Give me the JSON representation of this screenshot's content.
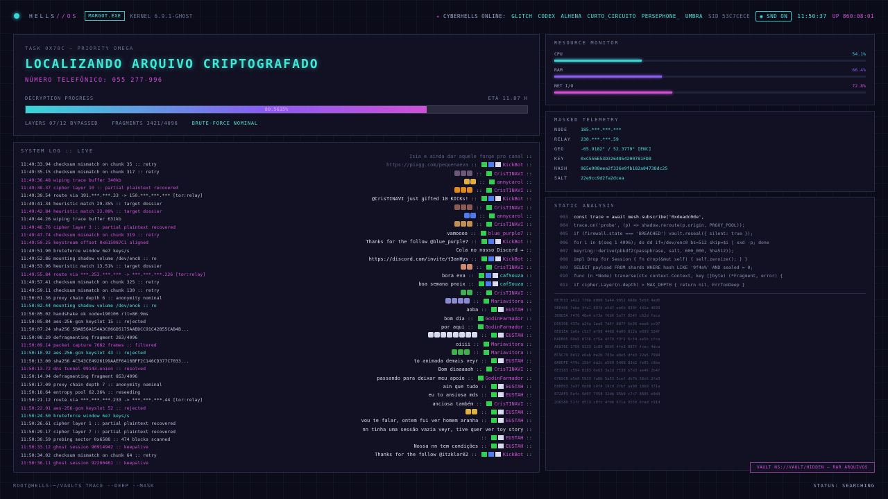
{
  "topbar": {
    "brand_a": "HELLS",
    "brand_b": "//OS",
    "exe": "MARGOT.EXE",
    "kernel": "KERNEL 6.9.1-GHOST",
    "online_label": "CYBERHELLS ONLINE:",
    "users": [
      "GLITCH",
      "CODEX",
      "ALHENA",
      "CURTO_CIRCUITO",
      "PERSEPHONE_",
      "UMBRA"
    ],
    "sid": "SID 53C7CECE",
    "snd": "SND ON",
    "clock": "11:50:37",
    "uptime": "UP 860:08:01"
  },
  "task": {
    "id": "TASK 0X70C — PRIORITY OMEGA",
    "title": "LOCALIZANDO ARQUIVO CRIPTOGRAFADO",
    "phone": "NÚMERO TELEFÔNICO: 055 277-996",
    "progress_label": "DECRYPTION PROGRESS",
    "eta": "ETA 11.87 H",
    "progress": 0.8,
    "progress_text": "80.5635%",
    "layers": "LAYERS 07/12 BYPASSED",
    "fragments": "FRAGMENTS 3421/4096",
    "mode": "BRUTE-FORCE NOMINAL"
  },
  "resource": {
    "title": "RESOURCE MONITOR",
    "items": [
      {
        "label": "CPU",
        "value": "54.1%",
        "level": 0.541,
        "color": "#38d6d6"
      },
      {
        "label": "RAM",
        "value": "66.4%",
        "level": 0.664,
        "color": "#8a5cf0"
      },
      {
        "label": "NET I/O",
        "value": "72.8%",
        "level": 0.728,
        "color": "#d050d8"
      }
    ]
  },
  "telemetry": {
    "title": "MASKED TELEMETRY",
    "rows": [
      {
        "k": "NODE",
        "v": "185.***.***.***"
      },
      {
        "k": "RELAY",
        "v": "230.***.***.59"
      },
      {
        "k": "GEO",
        "v": "-65.9182° / 52.3779° [ENC]"
      },
      {
        "k": "KEY",
        "v": "0xC556E53D3264854200781FDB"
      },
      {
        "k": "HASH",
        "v": "965e908eea2f336e9fb182a84738dc25"
      },
      {
        "k": "SALT",
        "v": "22e9cc9d2fa2dcea"
      }
    ]
  },
  "static": {
    "title": "STATIC ANALYSIS",
    "code": [
      {
        "n": "003",
        "t": "const trace = await mesh.subscribe('0xdeadc0de',",
        "hl": true
      },
      {
        "n": "004",
        "t": "trace.on('probe', (p) => shadow.reroute(p.origin, PROXY_POOL));",
        "hl": false
      },
      {
        "n": "005",
        "t": "if (firewall.state === 'BREACHED') vault.reseal({ silent: true });",
        "hl": false
      },
      {
        "n": "006",
        "t": "for i in $(seq 1 4096); do dd if=/dev/enc0 bs=512 skip=$i | xxd -p; done",
        "hl": false
      },
      {
        "n": "007",
        "t": "keyring::derive(pbkdf2(passphrase, salt, 600_000, Sha512));",
        "hl": false
      },
      {
        "n": "008",
        "t": "impl Drop for Session { fn drop(&mut self) { self.zeroize(); } }",
        "hl": false
      },
      {
        "n": "009",
        "t": "SELECT payload FROM shards WHERE hash LIKE '9f4a%' AND sealed = 0;",
        "hl": false
      },
      {
        "n": "010",
        "t": "func (n *Node) traverse(ctx context.Context, key []byte) (*Fragment, error) {",
        "hl": false
      },
      {
        "n": "011",
        "t": "if cipher.Layer(n.depth) > MAX_DEPTH { return nil, ErrTooDeep }",
        "hl": false
      }
    ],
    "hex": [
      "0E7033 a412 776b d000 5a44 9952 668e 5e58 4ad0",
      "5EE406 7ebe 3fa1 807d e5d7 eb6b 839f 441a 4693",
      "369D5A f476 48e4 ef3e f6b6 5a7f 854f c62d faca",
      "D55356 437e a24a 1ea6 7d5f 887f 6e36 eee8 cc97",
      "8E81EA 1a6a c927 af98 4468 4a06 812a e899 584f",
      "BADB05 60a5 8736 cf5a 4f70 f3f1 6cf4 ee5b cfca",
      "A6876C 1756 9133 1c89 86b5 4fe3 887f fcec 4dca",
      "EC9C79 8d12 e6ab de2b 703e a8e5 dfe3 22a5 7994",
      "8A0DFE 4f9c 15bf da2c e509 5488 83b2 fe05 c8be",
      "6E3183 c594 8183 6e63 3a2d f538 b7e3 ae46 2b47",
      "0789CB a5e0 5933 fa8b 5a53 5cef db7b 58c6 2fa3",
      "E86E63 3a37 0d08 c9f4 19cd 2fbf aa00 18b9 371a",
      "872AF3 6efc 9d07 7458 32db 95b9 c7c7 8895 e0d3",
      "206580 51fc d513 c0fc 4fdb 671e 9550 6cad c91d"
    ],
    "vault": "VAULT NS://VAULT/HIDDEN — RAR ARQUIVOS"
  },
  "syslog": {
    "title": "SYSTEM LOG :: LIVE",
    "lines": [
      {
        "t": "11:49:33.94 checksum mismatch on chunk 35 :: retry",
        "c": ""
      },
      {
        "t": "11:49:35.15 checksum mismatch on chunk 317 :: retry",
        "c": ""
      },
      {
        "t": "11:49:36.48 wiping trace buffer 340kb",
        "c": "pink"
      },
      {
        "t": "11:49:38.37 cipher layer 10 :: partial plaintext recovered",
        "c": "pink"
      },
      {
        "t": "11:49:39.54 route via 191.***.***.33 -> 150.***.***.*** [tor:relay]",
        "c": ""
      },
      {
        "t": "11:49:41.34 heuristic match 29.35% :: target dossier",
        "c": ""
      },
      {
        "t": "11:49:42.84 heuristic match 33.09% :: target dossier",
        "c": "pink"
      },
      {
        "t": "11:49:44.26 wiping trace buffer 631kb",
        "c": ""
      },
      {
        "t": "11:49:46.76 cipher layer 3 :: partial plaintext recovered",
        "c": "pink"
      },
      {
        "t": "11:49:47.74 checksum mismatch on chunk 319 :: retry",
        "c": "pink"
      },
      {
        "t": "11:49:50.25 keystream offset 0x615987C1 aligned",
        "c": "pink"
      },
      {
        "t": "11:49:51.90 bruteforce window 6e7 keys/s",
        "c": ""
      },
      {
        "t": "11:49:52.86 mounting shadow volume /dev/enc8 :: ro",
        "c": ""
      },
      {
        "t": "11:49:53.96 heuristic match 13.51% :: target dossier",
        "c": ""
      },
      {
        "t": "11:49:55.84 route via ***.253.***.*** -> ***.***.***.226 [tor:relay]",
        "c": "pink"
      },
      {
        "t": "11:49:57.41 checksum mismatch on chunk 325 :: retry",
        "c": ""
      },
      {
        "t": "11:49:59.11 checksum mismatch on chunk 130 :: retry",
        "c": ""
      },
      {
        "t": "11:50:01.36 proxy chain depth 6 :: anonymity nominal",
        "c": ""
      },
      {
        "t": "11:50:02.44 mounting shadow volume /dev/enc6 :: ro",
        "c": "cyan"
      },
      {
        "t": "11:50:05.02 handshake ok node=190106 rtt=86.9ms",
        "c": ""
      },
      {
        "t": "11:50:05.84 aes-256-gcm keyslot 15 :: rejected",
        "c": ""
      },
      {
        "t": "11:50:07.24 sha256 5BAB56A154A3C06GD5175AABDCC91C42B55CAB4B...",
        "c": ""
      },
      {
        "t": "11:50:08.29 defragmenting fragment 263/4096",
        "c": ""
      },
      {
        "t": "11:50:09.14 packet capture 7662 frames :: filtered",
        "c": "pink"
      },
      {
        "t": "11:50:10.92 aes-256-gcm keyslot 43 :: rejected",
        "c": "cyan"
      },
      {
        "t": "11:50:13.00 sha256 4C543CE4926199AAEF6416BFF2C146CD377C7033...",
        "c": ""
      },
      {
        "t": "11:50:13.72 dns tunnel 09143.onion :: resolved",
        "c": "pink"
      },
      {
        "t": "11:50:14.94 defragmenting fragment 853/4096",
        "c": ""
      },
      {
        "t": "11:50:17.09 proxy chain depth 7 :: anonymity nominal",
        "c": ""
      },
      {
        "t": "11:50:18.64 entropy pool 62.36% :: reseeding",
        "c": ""
      },
      {
        "t": "11:50:21.12 route via ***.***.***.233 -> ***.***.***.44 [tor:relay]",
        "c": ""
      },
      {
        "t": "11:50:22.01 aes-256-gcm keyslot 52 :: rejected",
        "c": "pink"
      },
      {
        "t": "11:50:24.50 bruteforce window 6e7 keys/s",
        "c": "cyan"
      },
      {
        "t": "11:50:26.61 cipher layer 1 :: partial plaintext recovered",
        "c": ""
      },
      {
        "t": "11:50:29.17 cipher layer 7 :: partial plaintext recovered",
        "c": ""
      },
      {
        "t": "11:50:30.59 probing sector 0x6588 :: 474 blocks scanned",
        "c": ""
      },
      {
        "t": "11:50:33.12 ghost session 90914942 :: keepalive",
        "c": "pink"
      },
      {
        "t": "11:50:34.02 checksum mismatch on chunk 64 :: retry",
        "c": ""
      },
      {
        "t": "11:50:36.11 ghost session 92200461 :: keepalive",
        "c": "pink"
      }
    ],
    "chat": [
      {
        "msg": "Isia e ainda dar aquele forge pro canal",
        "name": "",
        "nc": "#5c6280",
        "dim": true,
        "b": []
      },
      {
        "msg": "https://pixgg.com/pequenaeva",
        "name": "KickBot",
        "nc": "#d050d8",
        "dim": true,
        "b": [
          "g",
          "b",
          "w"
        ]
      },
      {
        "msg": "",
        "e": [
          "#6a5878",
          "#6a5878",
          "#6a5878"
        ],
        "name": "CrisTINAVI",
        "nc": "#d050d8",
        "dim": true,
        "b": [
          "g"
        ]
      },
      {
        "msg": "",
        "e": [
          "#e0b040",
          "#e0b040"
        ],
        "name": "annycarol",
        "nc": "#d050d8",
        "b": [
          "g"
        ]
      },
      {
        "msg": "",
        "e": [
          "#e08a20",
          "#e08a20",
          "#e08a20"
        ],
        "name": "CrisTINAVI",
        "nc": "#d050d8",
        "b": [
          "g"
        ]
      },
      {
        "msg": "@CrisTINAVI just gifted 10 KICKs!",
        "name": "KickBot",
        "nc": "#d050d8",
        "b": [
          "g",
          "b",
          "w"
        ]
      },
      {
        "msg": "",
        "e": [
          "#8a5a50",
          "#8a5a50",
          "#8a5a50"
        ],
        "name": "CrisTINAVI",
        "nc": "#d050d8",
        "b": [
          "g"
        ]
      },
      {
        "msg": "",
        "e": [
          "#4c7cf0",
          "#4c7cf0"
        ],
        "name": "annycarol",
        "nc": "#d050d8",
        "b": [
          "g"
        ]
      },
      {
        "msg": "",
        "e": [
          "#c09050",
          "#c09050",
          "#c09050"
        ],
        "name": "CrisTINAVI",
        "nc": "#d050d8",
        "b": [
          "g"
        ]
      },
      {
        "msg": "vamoooo",
        "name": "blue_purple7",
        "nc": "#d050d8",
        "b": [
          "g"
        ]
      },
      {
        "msg": "Thanks for the follow @blue_purple7",
        "name": "KickBot",
        "nc": "#d050d8",
        "b": [
          "g",
          "b",
          "w"
        ]
      },
      {
        "msg": "Cola no nosso Discord →",
        "name": "",
        "nc": "#d9dcee",
        "b": []
      },
      {
        "msg": "https://discord.com/invite/t3anHys",
        "name": "KickBot",
        "nc": "#d050d8",
        "b": [
          "g",
          "b",
          "w"
        ]
      },
      {
        "msg": "",
        "e": [
          "#d08a70",
          "#d08a70"
        ],
        "name": "CrisTINAVI",
        "nc": "#d050d8",
        "b": [
          "g"
        ]
      },
      {
        "msg": "bora eva",
        "name": "cafSouza",
        "nc": "#46e3d8",
        "b": [
          "g",
          "b",
          "w"
        ]
      },
      {
        "msg": "boa semana pnoix",
        "name": "cafSouza",
        "nc": "#46e3d8",
        "b": [
          "g",
          "b",
          "w"
        ]
      },
      {
        "msg": "",
        "e": [
          "#40b050",
          "#40b050"
        ],
        "name": "CrisTINAVI",
        "nc": "#d050d8",
        "b": [
          "g"
        ]
      },
      {
        "msg": "",
        "e": [
          "#8a8ad0",
          "#8a8ad0",
          "#8a8ad0",
          "#8a8ad0"
        ],
        "name": "Mariavitora",
        "nc": "#d050d8",
        "b": [
          "g"
        ]
      },
      {
        "msg": "aoba",
        "name": "EUSTAH",
        "nc": "#d050d8",
        "b": [
          "g",
          "w"
        ]
      },
      {
        "msg": "bom dia",
        "name": "GodinFarmador",
        "nc": "#d050d8",
        "b": [
          "g"
        ]
      },
      {
        "msg": "por aqui",
        "name": "GodinFarmador",
        "nc": "#d050d8",
        "b": [
          "g"
        ]
      },
      {
        "msg": "",
        "e": [
          "#d9dcee",
          "#d9dcee",
          "#d9dcee",
          "#d9dcee",
          "#d9dcee",
          "#d9dcee",
          "#d9dcee",
          "#d9dcee"
        ],
        "name": "EUSTAH",
        "nc": "#d050d8",
        "b": [
          "g",
          "w"
        ]
      },
      {
        "msg": "oiiii",
        "name": "Mariavitora",
        "nc": "#d050d8",
        "b": [
          "g"
        ]
      },
      {
        "msg": "",
        "e": [
          "#40b050",
          "#40b050",
          "#40b050"
        ],
        "name": "Mariavitora",
        "nc": "#d050d8",
        "b": [
          "g"
        ]
      },
      {
        "msg": "to animada demais veyr",
        "name": "EUSTAH",
        "nc": "#d050d8",
        "b": [
          "g",
          "w"
        ]
      },
      {
        "msg": "Bom diaaaaah",
        "name": "CrisTINAVI",
        "nc": "#d050d8",
        "b": [
          "g"
        ]
      },
      {
        "msg": "passando para deixar meu apoio",
        "name": "GodinFarmador",
        "nc": "#d050d8",
        "b": [
          "g"
        ]
      },
      {
        "msg": "ain que tudo",
        "name": "EUSTAH",
        "nc": "#d050d8",
        "b": [
          "g",
          "w"
        ]
      },
      {
        "msg": "eu to ansiosa mds",
        "name": "EUSTAH",
        "nc": "#d050d8",
        "b": [
          "g",
          "w"
        ]
      },
      {
        "msg": "anciosa também",
        "name": "CrisTINAVI",
        "nc": "#d050d8",
        "b": [
          "g"
        ]
      },
      {
        "msg": "",
        "e": [
          "#e0b040",
          "#e0b040"
        ],
        "name": "EUSTAH",
        "nc": "#d050d8",
        "b": [
          "g",
          "w"
        ]
      },
      {
        "msg": "vou te falar, ontem fui ver homem aranha",
        "name": "EUSTAH",
        "nc": "#d050d8",
        "b": [
          "g",
          "w"
        ]
      },
      {
        "msg": "nn tinha uma sessão vazia veyr, tive quer ver toy story",
        "name": "",
        "nc": "#d9dcee",
        "b": []
      },
      {
        "msg": "",
        "name": "EUSTAH",
        "nc": "#d050d8",
        "b": [
          "g",
          "w"
        ]
      },
      {
        "msg": "Nossa nn tem condições",
        "name": "EUSTAH",
        "nc": "#d050d8",
        "b": [
          "g",
          "w"
        ]
      },
      {
        "msg": "Thanks for the follow @itzklar02",
        "name": "KickBot",
        "nc": "#d050d8",
        "b": [
          "g",
          "b",
          "w"
        ]
      }
    ]
  },
  "bottombar": {
    "prompt": "ROOT@HELLS:~/VAULT$ TRACE --DEEP --MASK",
    "status": "STATUS: SEARCHING"
  }
}
